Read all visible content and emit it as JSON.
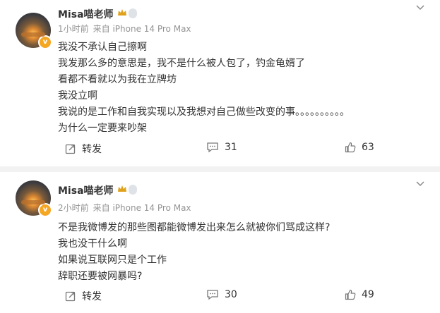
{
  "posts": [
    {
      "username": "Misa喵老师",
      "level": "",
      "time": "1小时前",
      "source": "来自 iPhone 14 Pro Max",
      "lines": [
        "我没不承认自己擦啊",
        "我发那么多的意思是，我不是什么被人包了，钓金龟婿了",
        "看都不看就以为我在立牌坊",
        "我没立啊",
        "我说的是工作和自我实现以及我想对自己做些改变的事。。。。。。。。。。",
        "为什么一定要来吵架"
      ],
      "repost_label": "转发",
      "comments": "31",
      "likes": "63"
    },
    {
      "username": "Misa喵老师",
      "level": "",
      "time": "2小时前",
      "source": "来自 iPhone 14 Pro Max",
      "lines": [
        "不是我微博发的那些图都能微博发出来怎么就被你们骂成这样?",
        "我也没干什么啊",
        "如果说互联网只是个工作",
        "辞职还要被网暴吗?"
      ],
      "repost_label": "转发",
      "comments": "30",
      "likes": "49"
    }
  ],
  "colors": {
    "accent_badge": "#f5a623",
    "text": "#333333",
    "meta": "#939393",
    "crown": "#e0a21c"
  },
  "icons": [
    "avatar",
    "verified-badge-icon",
    "crown-icon",
    "chevron-down-icon",
    "repost-icon",
    "comment-icon",
    "like-icon"
  ]
}
